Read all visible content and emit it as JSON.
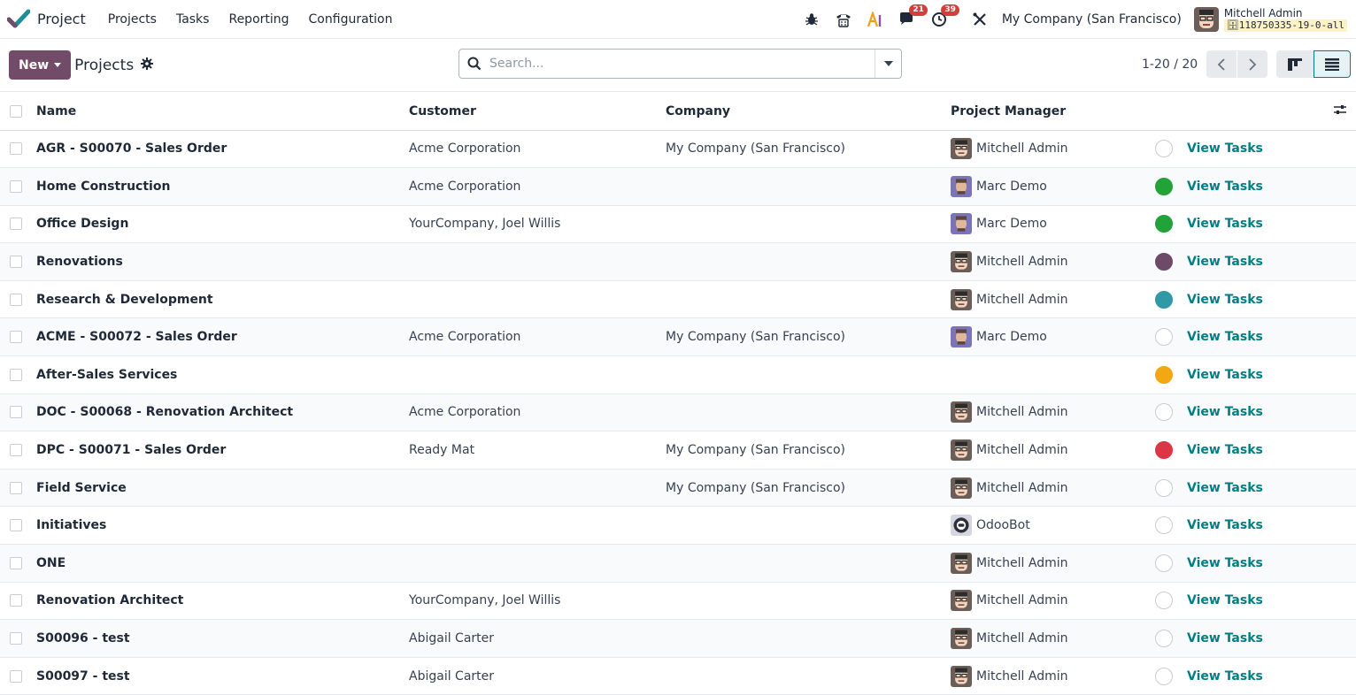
{
  "app": {
    "name": "Project"
  },
  "menu": [
    {
      "label": "Projects"
    },
    {
      "label": "Tasks"
    },
    {
      "label": "Reporting"
    },
    {
      "label": "Configuration"
    }
  ],
  "systray": {
    "messages_count": "21",
    "activities_count": "39",
    "company": "My Company (San Francisco)",
    "user_name": "Mitchell Admin",
    "db_name": "118750335-19-0-all"
  },
  "control": {
    "new_label": "New",
    "breadcrumb": "Projects",
    "search_placeholder": "Search...",
    "pager": "1-20 / 20"
  },
  "table": {
    "headers": {
      "name": "Name",
      "customer": "Customer",
      "company": "Company",
      "manager": "Project Manager"
    },
    "rows": [
      {
        "name": "AGR - S00070 - Sales Order",
        "customer": "Acme Corporation",
        "company": "My Company (San Francisco)",
        "manager": "Mitchell Admin",
        "avatar": "mitchell",
        "status": "#ffffff",
        "action": "View Tasks"
      },
      {
        "name": "Home Construction",
        "customer": "Acme Corporation",
        "company": "",
        "manager": "Marc Demo",
        "avatar": "marc",
        "status": "#21a33a",
        "action": "View Tasks"
      },
      {
        "name": "Office Design",
        "customer": "YourCompany, Joel Willis",
        "company": "",
        "manager": "Marc Demo",
        "avatar": "marc",
        "status": "#21a33a",
        "action": "View Tasks"
      },
      {
        "name": "Renovations",
        "customer": "",
        "company": "",
        "manager": "Mitchell Admin",
        "avatar": "mitchell",
        "status": "#6d4a68",
        "action": "View Tasks"
      },
      {
        "name": "Research & Development",
        "customer": "",
        "company": "",
        "manager": "Mitchell Admin",
        "avatar": "mitchell",
        "status": "#2f9aa5",
        "action": "View Tasks"
      },
      {
        "name": "ACME - S00072 - Sales Order",
        "customer": "Acme Corporation",
        "company": "My Company (San Francisco)",
        "manager": "Marc Demo",
        "avatar": "marc",
        "status": "#ffffff",
        "action": "View Tasks"
      },
      {
        "name": "After-Sales Services",
        "customer": "",
        "company": "",
        "manager": "",
        "avatar": "",
        "status": "#f3a712",
        "action": "View Tasks"
      },
      {
        "name": "DOC - S00068 - Renovation Architect",
        "customer": "Acme Corporation",
        "company": "",
        "manager": "Mitchell Admin",
        "avatar": "mitchell",
        "status": "#ffffff",
        "action": "View Tasks"
      },
      {
        "name": "DPC - S00071 - Sales Order",
        "customer": "Ready Mat",
        "company": "My Company (San Francisco)",
        "manager": "Mitchell Admin",
        "avatar": "mitchell",
        "status": "#dc3545",
        "action": "View Tasks"
      },
      {
        "name": "Field Service",
        "customer": "",
        "company": "My Company (San Francisco)",
        "manager": "Mitchell Admin",
        "avatar": "mitchell",
        "status": "#ffffff",
        "action": "View Tasks"
      },
      {
        "name": "Initiatives",
        "customer": "",
        "company": "",
        "manager": "OdooBot",
        "avatar": "odoobot",
        "status": "#ffffff",
        "action": "View Tasks"
      },
      {
        "name": "ONE",
        "customer": "",
        "company": "",
        "manager": "Mitchell Admin",
        "avatar": "mitchell",
        "status": "#ffffff",
        "action": "View Tasks"
      },
      {
        "name": "Renovation Architect",
        "customer": "YourCompany, Joel Willis",
        "company": "",
        "manager": "Mitchell Admin",
        "avatar": "mitchell",
        "status": "#ffffff",
        "action": "View Tasks"
      },
      {
        "name": "S00096 - test",
        "customer": "Abigail Carter",
        "company": "",
        "manager": "Mitchell Admin",
        "avatar": "mitchell",
        "status": "#ffffff",
        "action": "View Tasks"
      },
      {
        "name": "S00097 - test",
        "customer": "Abigail Carter",
        "company": "",
        "manager": "Mitchell Admin",
        "avatar": "mitchell",
        "status": "#ffffff",
        "action": "View Tasks"
      }
    ]
  },
  "colors": {
    "primary": "#714b67",
    "link": "#017e84",
    "badge": "#d23f3a"
  }
}
